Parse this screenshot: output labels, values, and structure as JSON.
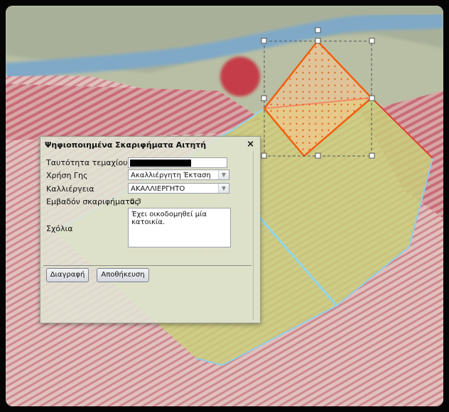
{
  "dialog": {
    "title": "Ψηφιοποιημένα Σκαριφήματα Αιτητή",
    "close_glyph": "×",
    "fields": {
      "parcel_id_label": "Ταυτότητα τεμαχίου",
      "land_use_label": "Χρήση Γης",
      "land_use_value": "Ακαλλιέργητη Έκταση",
      "cultivation_label": "Καλλιέργεια",
      "cultivation_value": "ΑΚΑΛΛΙΕΡΓΗΤΟ",
      "area_label": "Εμβαδόν σκαριφήματος",
      "area_value": "0,3",
      "comments_label": "Σχόλια",
      "comments_value": "Έχει οικοδομηθεί μία κατοικία."
    },
    "buttons": {
      "delete_label": "Διαγραφή",
      "save_label": "Αποθήκευση"
    },
    "dropdown_icon": "chevron-down-icon"
  },
  "map": {
    "parcel_fill_color": "#c8d07a",
    "parcel_outline_color": "#e0402a",
    "parcel_outline_secondary_color": "#8fd6ee",
    "sketch_outline_color": "#f06010",
    "sketch_fill_color": "#ffc890",
    "selection_box_color": "#555555"
  }
}
